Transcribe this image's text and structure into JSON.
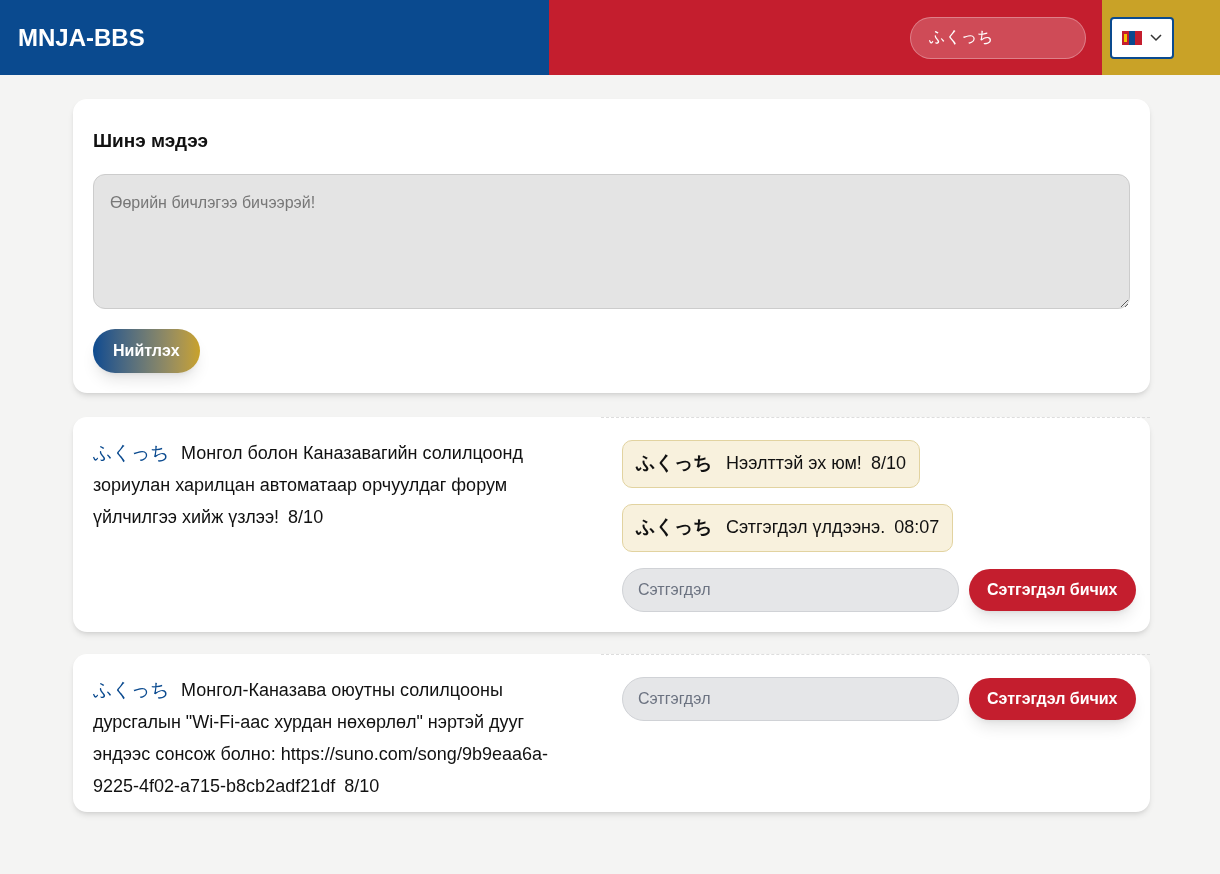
{
  "header": {
    "title": "MNJA-BBS",
    "name_field": {
      "value": "ふくっち"
    },
    "language_select": {
      "expanded": false
    }
  },
  "composer": {
    "heading": "Шинэ мэдээ",
    "placeholder": "Өөрийн бичлэгээ бичээрэй!",
    "submit": "Нийтлэх"
  },
  "posts": [
    {
      "author": "ふくっち",
      "text": "Монгол болон Каназавагийн солилцоонд зориулан харилцан автоматаар орчуулдаг форум үйлчилгээ хийж үзлээ!",
      "date": "8/10",
      "comments": [
        {
          "author": "ふくっち",
          "text": "Нээлттэй эх юм!",
          "date": "8/10"
        },
        {
          "author": "ふくっち",
          "text": "Сэтгэгдэл үлдээнэ.",
          "date": "08:07"
        }
      ],
      "comment_placeholder": "Сэтгэгдэл",
      "comment_button": "Сэтгэгдэл бичих"
    },
    {
      "author": "ふくっち",
      "text": "Монгол-Каназава оюутны солилцооны дурсгалын \"Wi-Fi-аас хурдан нөхөрлөл\" нэртэй дууг эндээс сонсож болно: https://suno.com/song/9b9eaa6a-9225-4f02-a715-b8cb2adf21df",
      "date": "8/10",
      "comment_placeholder": "Сэтгэгдэл",
      "comment_button": "Сэтгэгдэл бичих"
    }
  ]
}
